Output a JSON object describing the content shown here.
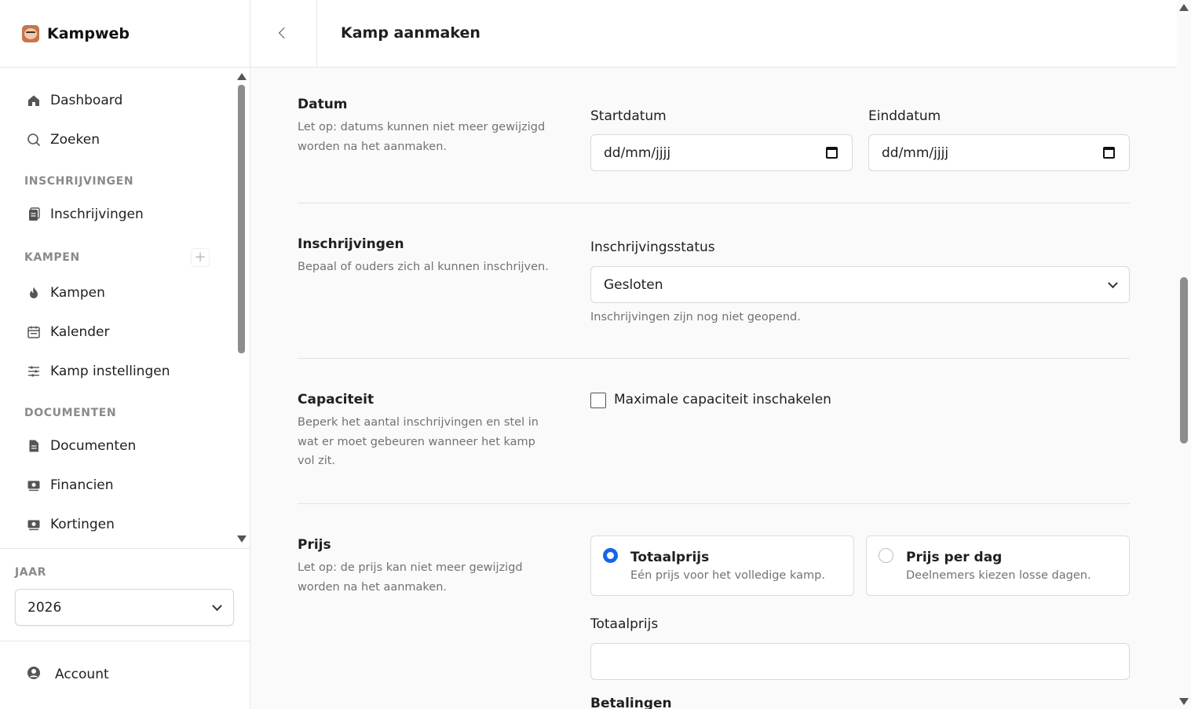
{
  "app": {
    "name": "Kampweb"
  },
  "header": {
    "title": "Kamp aanmaken"
  },
  "sidebar": {
    "items": [
      {
        "label": "Dashboard",
        "icon": "home-icon"
      },
      {
        "label": "Zoeken",
        "icon": "search-icon"
      }
    ],
    "sections": [
      {
        "title": "INSCHRIJVINGEN",
        "items": [
          {
            "label": "Inschrijvingen",
            "icon": "clipboard-icon"
          }
        ]
      },
      {
        "title": "KAMPEN",
        "items": [
          {
            "label": "Kampen",
            "icon": "fire-icon"
          },
          {
            "label": "Kalender",
            "icon": "calendar-icon"
          },
          {
            "label": "Kamp instellingen",
            "icon": "sliders-icon"
          }
        ]
      },
      {
        "title": "DOCUMENTEN",
        "items": [
          {
            "label": "Documenten",
            "icon": "document-icon"
          },
          {
            "label": "Financien",
            "icon": "money-icon"
          },
          {
            "label": "Kortingen",
            "icon": "money-icon"
          }
        ]
      }
    ],
    "year": {
      "label": "JAAR",
      "value": "2026"
    },
    "account": {
      "label": "Account"
    }
  },
  "form": {
    "datum": {
      "title": "Datum",
      "description": "Let op: datums kunnen niet meer gewijzigd worden na het aanmaken.",
      "start_label": "Startdatum",
      "start_placeholder": "dd/mm/jjjj",
      "end_label": "Einddatum",
      "end_placeholder": "dd/mm/jjjj"
    },
    "inschrijvingen": {
      "title": "Inschrijvingen",
      "description": "Bepaal of ouders zich al kunnen inschrijven.",
      "status_label": "Inschrijvingsstatus",
      "status_value": "Gesloten",
      "helper": "Inschrijvingen zijn nog niet geopend."
    },
    "capaciteit": {
      "title": "Capaciteit",
      "description": "Beperk het aantal inschrijvingen en stel in wat er moet gebeuren wanneer het kamp vol zit.",
      "checkbox_label": "Maximale capaciteit inschakelen",
      "checked": false
    },
    "prijs": {
      "title": "Prijs",
      "description": "Let op: de prijs kan niet meer gewijzigd worden na het aanmaken.",
      "options": [
        {
          "title": "Totaalprijs",
          "description": "Eén prijs voor het volledige kamp.",
          "selected": true
        },
        {
          "title": "Prijs per dag",
          "description": "Deelnemers kiezen losse dagen.",
          "selected": false
        }
      ],
      "total_label": "Totaalprijs",
      "total_value": "",
      "next_label": "Betalingen"
    }
  },
  "colors": {
    "accent": "#1565e8",
    "muted_text": "#727272",
    "border": "#d9d9d9"
  }
}
